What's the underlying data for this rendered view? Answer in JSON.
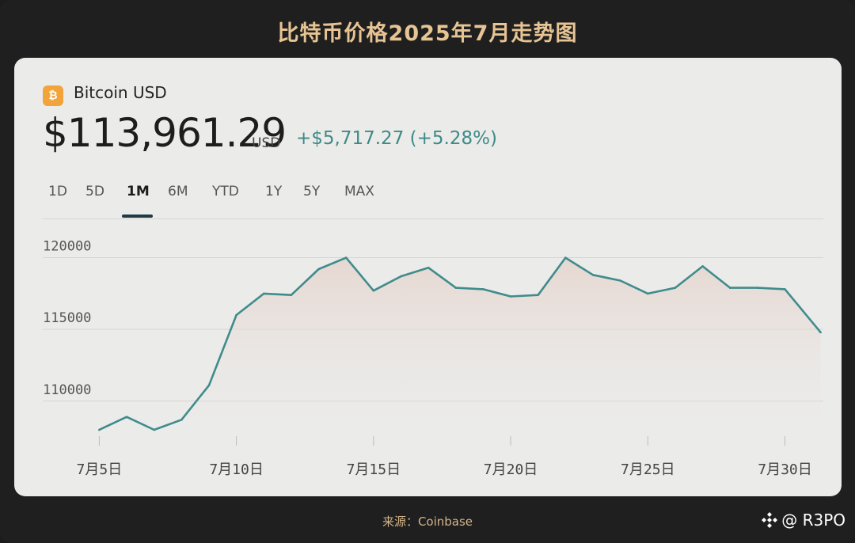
{
  "header": {
    "title": "比特币价格2025年7月走势图"
  },
  "card": {
    "asset_icon": "bitcoin-icon",
    "asset_icon_glyph": "₿",
    "asset_name": "Bitcoin USD",
    "price": "$113,961.29",
    "currency": "USD",
    "change": "+$5,717.27 (+5.28%)"
  },
  "tabs": [
    "1D",
    "5D",
    "1M",
    "6M",
    "YTD",
    "1Y",
    "5Y",
    "MAX"
  ],
  "active_tab": "1M",
  "colors": {
    "line": "#3f8c8c",
    "area_top": "#e6d6cf",
    "title": "#e7c494",
    "change_positive": "#3e8a86",
    "btc_orange": "#f2a33a"
  },
  "chart_data": {
    "type": "area",
    "title": "",
    "xlabel": "",
    "ylabel": "",
    "x_tick_labels": [
      "7月5日",
      "7月10日",
      "7月15日",
      "7月20日",
      "7月25日",
      "7月30日"
    ],
    "x_tick_days": [
      5,
      10,
      15,
      20,
      25,
      30
    ],
    "y_ticks": [
      110000,
      115000,
      120000
    ],
    "y_tick_labels": [
      "110000",
      "115000",
      "120000"
    ],
    "xlim": [
      1.9,
      31.4
    ],
    "ylim": [
      108000,
      122900
    ],
    "grid": true,
    "series": [
      {
        "x": [
          5,
          6,
          7,
          8,
          9,
          10,
          11,
          12,
          13,
          14,
          15,
          16,
          17,
          18,
          19,
          20,
          21,
          22,
          23,
          24,
          25,
          26,
          27,
          28,
          29,
          30,
          31.3
        ],
        "values": [
          108000,
          108900,
          108000,
          108700,
          111100,
          116000,
          117500,
          117400,
          119200,
          120000,
          117700,
          118700,
          119300,
          117900,
          117800,
          117300,
          117400,
          120000,
          118800,
          118400,
          117500,
          117900,
          119400,
          117900,
          117900,
          117800,
          114800
        ]
      }
    ]
  },
  "footer": {
    "source": "来源：Coinbase",
    "watermark": "@ R3PO"
  }
}
